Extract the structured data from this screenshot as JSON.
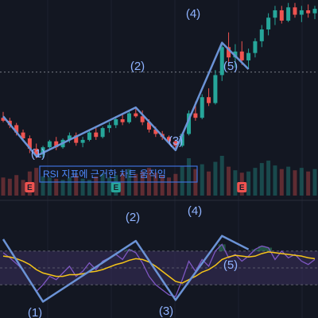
{
  "chart_data": [
    {
      "type": "candlestick",
      "panel": "price",
      "colors": {
        "up": "#26a69a",
        "down": "#ef5350",
        "wave_line": "#6b93d6",
        "ref_line": "#d1d4dc"
      },
      "candles": [
        {
          "o": 110,
          "h": 118,
          "l": 104,
          "c": 106
        },
        {
          "o": 106,
          "h": 110,
          "l": 96,
          "c": 100
        },
        {
          "o": 100,
          "h": 103,
          "l": 86,
          "c": 90
        },
        {
          "o": 90,
          "h": 94,
          "l": 78,
          "c": 82
        },
        {
          "o": 82,
          "h": 86,
          "l": 62,
          "c": 68
        },
        {
          "o": 68,
          "h": 75,
          "l": 55,
          "c": 60
        },
        {
          "o": 60,
          "h": 72,
          "l": 56,
          "c": 70
        },
        {
          "o": 70,
          "h": 80,
          "l": 66,
          "c": 78
        },
        {
          "o": 78,
          "h": 84,
          "l": 66,
          "c": 70
        },
        {
          "o": 70,
          "h": 82,
          "l": 68,
          "c": 80
        },
        {
          "o": 80,
          "h": 90,
          "l": 76,
          "c": 86
        },
        {
          "o": 86,
          "h": 90,
          "l": 72,
          "c": 76
        },
        {
          "o": 76,
          "h": 84,
          "l": 70,
          "c": 80
        },
        {
          "o": 80,
          "h": 92,
          "l": 78,
          "c": 90
        },
        {
          "o": 90,
          "h": 96,
          "l": 80,
          "c": 84
        },
        {
          "o": 84,
          "h": 98,
          "l": 82,
          "c": 96
        },
        {
          "o": 96,
          "h": 104,
          "l": 90,
          "c": 100
        },
        {
          "o": 100,
          "h": 112,
          "l": 96,
          "c": 108
        },
        {
          "o": 108,
          "h": 116,
          "l": 100,
          "c": 104
        },
        {
          "o": 104,
          "h": 120,
          "l": 102,
          "c": 116
        },
        {
          "o": 116,
          "h": 124,
          "l": 110,
          "c": 112
        },
        {
          "o": 112,
          "h": 120,
          "l": 100,
          "c": 104
        },
        {
          "o": 104,
          "h": 108,
          "l": 90,
          "c": 94
        },
        {
          "o": 94,
          "h": 98,
          "l": 84,
          "c": 88
        },
        {
          "o": 88,
          "h": 92,
          "l": 80,
          "c": 84
        },
        {
          "o": 84,
          "h": 86,
          "l": 74,
          "c": 78
        },
        {
          "o": 78,
          "h": 80,
          "l": 68,
          "c": 72
        },
        {
          "o": 72,
          "h": 90,
          "l": 70,
          "c": 88
        },
        {
          "o": 88,
          "h": 120,
          "l": 86,
          "c": 116
        },
        {
          "o": 116,
          "h": 132,
          "l": 106,
          "c": 110
        },
        {
          "o": 110,
          "h": 142,
          "l": 108,
          "c": 138
        },
        {
          "o": 138,
          "h": 150,
          "l": 126,
          "c": 130
        },
        {
          "o": 130,
          "h": 175,
          "l": 128,
          "c": 168
        },
        {
          "o": 168,
          "h": 212,
          "l": 160,
          "c": 206
        },
        {
          "o": 206,
          "h": 226,
          "l": 186,
          "c": 192
        },
        {
          "o": 192,
          "h": 210,
          "l": 178,
          "c": 200
        },
        {
          "o": 200,
          "h": 214,
          "l": 182,
          "c": 188
        },
        {
          "o": 188,
          "h": 204,
          "l": 176,
          "c": 198
        },
        {
          "o": 198,
          "h": 218,
          "l": 192,
          "c": 214
        },
        {
          "o": 214,
          "h": 236,
          "l": 206,
          "c": 230
        },
        {
          "o": 230,
          "h": 252,
          "l": 222,
          "c": 246
        },
        {
          "o": 246,
          "h": 262,
          "l": 236,
          "c": 256
        },
        {
          "o": 256,
          "h": 262,
          "l": 238,
          "c": 242
        },
        {
          "o": 242,
          "h": 266,
          "l": 240,
          "c": 260
        },
        {
          "o": 260,
          "h": 266,
          "l": 246,
          "c": 250
        },
        {
          "o": 250,
          "h": 262,
          "l": 240,
          "c": 256
        },
        {
          "o": 256,
          "h": 264,
          "l": 246,
          "c": 252
        },
        {
          "o": 252,
          "h": 262,
          "l": 244,
          "c": 258
        }
      ],
      "volume": [
        30,
        28,
        34,
        26,
        40,
        46,
        32,
        30,
        28,
        26,
        30,
        34,
        28,
        26,
        32,
        36,
        30,
        34,
        38,
        44,
        36,
        40,
        46,
        38,
        34,
        30,
        36,
        48,
        62,
        44,
        52,
        40,
        56,
        66,
        48,
        42,
        38,
        40,
        46,
        54,
        58,
        50,
        44,
        48,
        42,
        46,
        40,
        44
      ],
      "wave_points": [
        {
          "label": "(1)",
          "at": 5,
          "price": 58
        },
        {
          "label": "(2)",
          "at": 20,
          "price": 124
        },
        {
          "label": "(3)",
          "at": 26,
          "price": 66
        },
        {
          "label": "(4)",
          "at": 33,
          "price": 212
        },
        {
          "label": "(5)",
          "at": 37,
          "price": 176
        }
      ],
      "dotted_level": 172,
      "event_marker_labels": [
        "E",
        "E",
        "E"
      ],
      "annotation": "RSI 지표에 근거한 차트 움직임"
    },
    {
      "type": "line",
      "panel": "rsi",
      "ylim": [
        0,
        100
      ],
      "band": [
        30,
        70
      ],
      "middle": 50,
      "colors": {
        "rsi": "#7e57c2",
        "ma": "#f5c518",
        "band_fill": "#3a2f5c",
        "wave_line": "#6b93d6"
      },
      "series": [
        {
          "values": [
            68,
            62,
            55,
            48,
            34,
            22,
            30,
            40,
            36,
            44,
            52,
            40,
            46,
            56,
            48,
            58,
            62,
            66,
            60,
            72,
            68,
            56,
            40,
            30,
            24,
            18,
            16,
            36,
            58,
            46,
            60,
            52,
            70,
            78,
            62,
            66,
            58,
            64,
            72,
            76,
            74,
            60,
            70,
            62,
            66,
            58,
            54,
            60
          ]
        },
        {
          "values": [
            64,
            63,
            61,
            58,
            54,
            48,
            44,
            42,
            40,
            40,
            42,
            42,
            43,
            45,
            46,
            48,
            51,
            54,
            56,
            59,
            61,
            60,
            57,
            52,
            46,
            40,
            34,
            32,
            36,
            40,
            45,
            48,
            53,
            60,
            63,
            65,
            64,
            63,
            64,
            67,
            69,
            68,
            67,
            66,
            65,
            64,
            62,
            61
          ]
        }
      ],
      "wave_points": [
        {
          "label": "(1)",
          "at": 6,
          "value": 10
        },
        {
          "label": "(2)",
          "at": 20,
          "value": 82
        },
        {
          "label": "(3)",
          "at": 26,
          "value": 12
        },
        {
          "label": "(4)",
          "at": 33,
          "value": 88
        },
        {
          "label": "(5)",
          "at": 37,
          "value": 72
        }
      ]
    }
  ]
}
